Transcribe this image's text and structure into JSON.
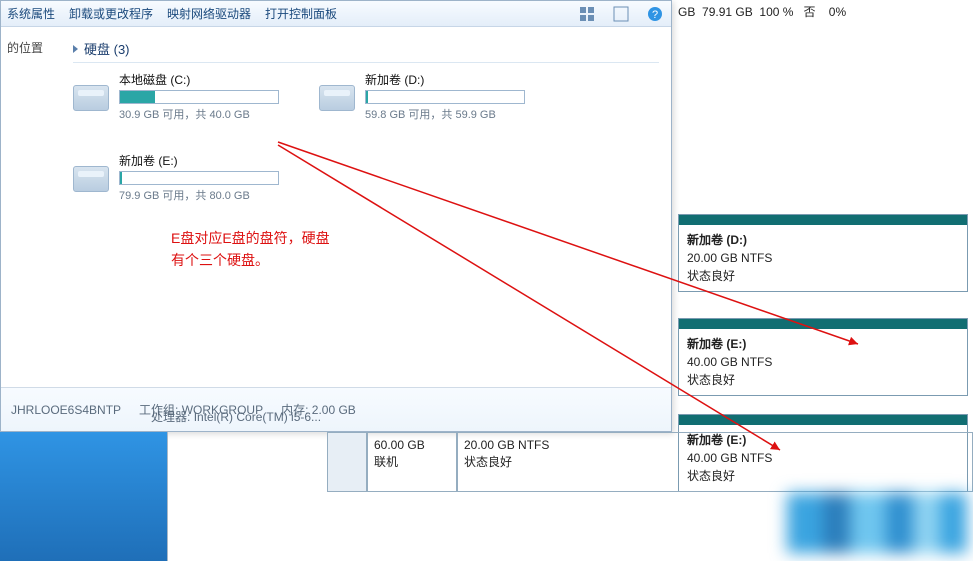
{
  "toolbar": {
    "sysprops": "系统属性",
    "uninstall": "卸载或更改程序",
    "mapdrive": "映射网络驱动器",
    "controlpanel": "打开控制面板"
  },
  "nav": {
    "loc": "的位置"
  },
  "section": {
    "title": "硬盘 (3)"
  },
  "drives": {
    "c": {
      "name": "本地磁盘 (C:)",
      "stats": "30.9 GB 可用，共 40.0 GB",
      "fill": "22%"
    },
    "d": {
      "name": "新加卷 (D:)",
      "stats": "59.8 GB 可用，共 59.9 GB",
      "fill": "1%"
    },
    "e": {
      "name": "新加卷 (E:)",
      "stats": "79.9 GB 可用，共 80.0 GB",
      "fill": "1%"
    }
  },
  "annotation": {
    "line1": "E盘对应E盘的盘符，硬盘",
    "line2": "有个三个硬盘。"
  },
  "footer": {
    "host": "JHRLOOE6S4BNTP",
    "wg_lbl": "工作组:",
    "wg": "WORKGROUP",
    "cpu_lbl": "处理器:",
    "cpu": "Intel(R) Core(TM) i5-6...",
    "mem_lbl": "内存:",
    "mem": "2.00 GB"
  },
  "rt": {
    "gb": "GB",
    "free": "79.91 GB",
    "pct": "100 %",
    "no": "否",
    "zero": "0%"
  },
  "dm": {
    "d": {
      "title": "新加卷  (D:)",
      "size": "20.00 GB NTFS",
      "state": "状态良好"
    },
    "e1": {
      "title": "新加卷  (E:)",
      "size": "40.00 GB NTFS",
      "state": "状态良好"
    },
    "e2": {
      "title": "新加卷  (E:)",
      "size": "40.00 GB NTFS",
      "state": "状态良好"
    }
  },
  "low": {
    "c1": {
      "size": "60.00 GB",
      "state": "联机"
    },
    "c2": {
      "size": "20.00 GB NTFS",
      "state": "状态良好"
    }
  }
}
